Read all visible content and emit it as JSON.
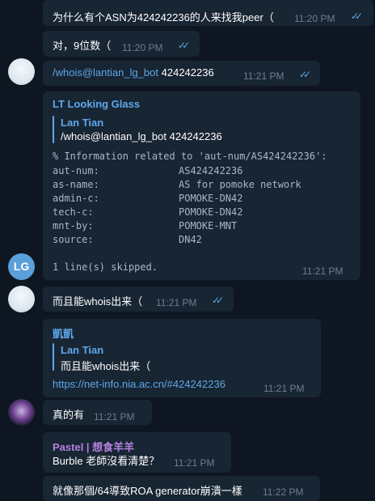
{
  "messages": {
    "m1": {
      "text": "为什么有个ASN为424242236的人来找我peer（",
      "time": "11:20 PM"
    },
    "m2": {
      "text": "对，9位数（",
      "time": "11:20 PM"
    },
    "m3": {
      "command": "/whois@lantian_lg_bot",
      "arg": "424242236",
      "time": "11:21 PM"
    },
    "m4": {
      "sender": "LT Looking Glass",
      "avatar_initials": "LG",
      "reply_name": "Lan Tian",
      "reply_text": "/whois@lantian_lg_bot 424242236",
      "header": "% Information related to 'aut-num/AS424242236':",
      "fields": [
        {
          "key": "aut-num:",
          "value": "AS424242236"
        },
        {
          "key": "as-name:",
          "value": "AS for pomoke network"
        },
        {
          "key": "admin-c:",
          "value": "POMOKE-DN42"
        },
        {
          "key": "tech-c:",
          "value": "POMOKE-DN42"
        },
        {
          "key": "mnt-by:",
          "value": "POMOKE-MNT"
        },
        {
          "key": "source:",
          "value": "DN42"
        }
      ],
      "footer": "1 line(s) skipped.",
      "time": "11:21 PM"
    },
    "m5": {
      "text": "而且能whois出来（",
      "time": "11:21 PM"
    },
    "m6": {
      "sender": "凱凱",
      "reply_name": "Lan Tian",
      "reply_text": "而且能whois出来（",
      "link": "https://net-info.nia.ac.cn/#424242236",
      "time": "11:21 PM"
    },
    "m7": {
      "text": "真的有",
      "time": "11:21 PM"
    },
    "m8": {
      "sender": "Pastel | 想食羊羊",
      "text": "Burble 老師沒看清楚？",
      "time": "11:21 PM"
    },
    "m9": {
      "text": "就像那個/64導致ROA generator崩潰一樣",
      "time": "11:22 PM"
    }
  },
  "colors": {
    "background": "#0e1621",
    "bubble": "#182533",
    "accent": "#5ea8ea",
    "sender_lg": "#5ea8ea",
    "sender_kai": "#5ea8ea",
    "sender_pastel": "#b582e0",
    "timestamp": "#6d7f8f"
  },
  "icons": {
    "read_receipt": "double-check-icon"
  }
}
